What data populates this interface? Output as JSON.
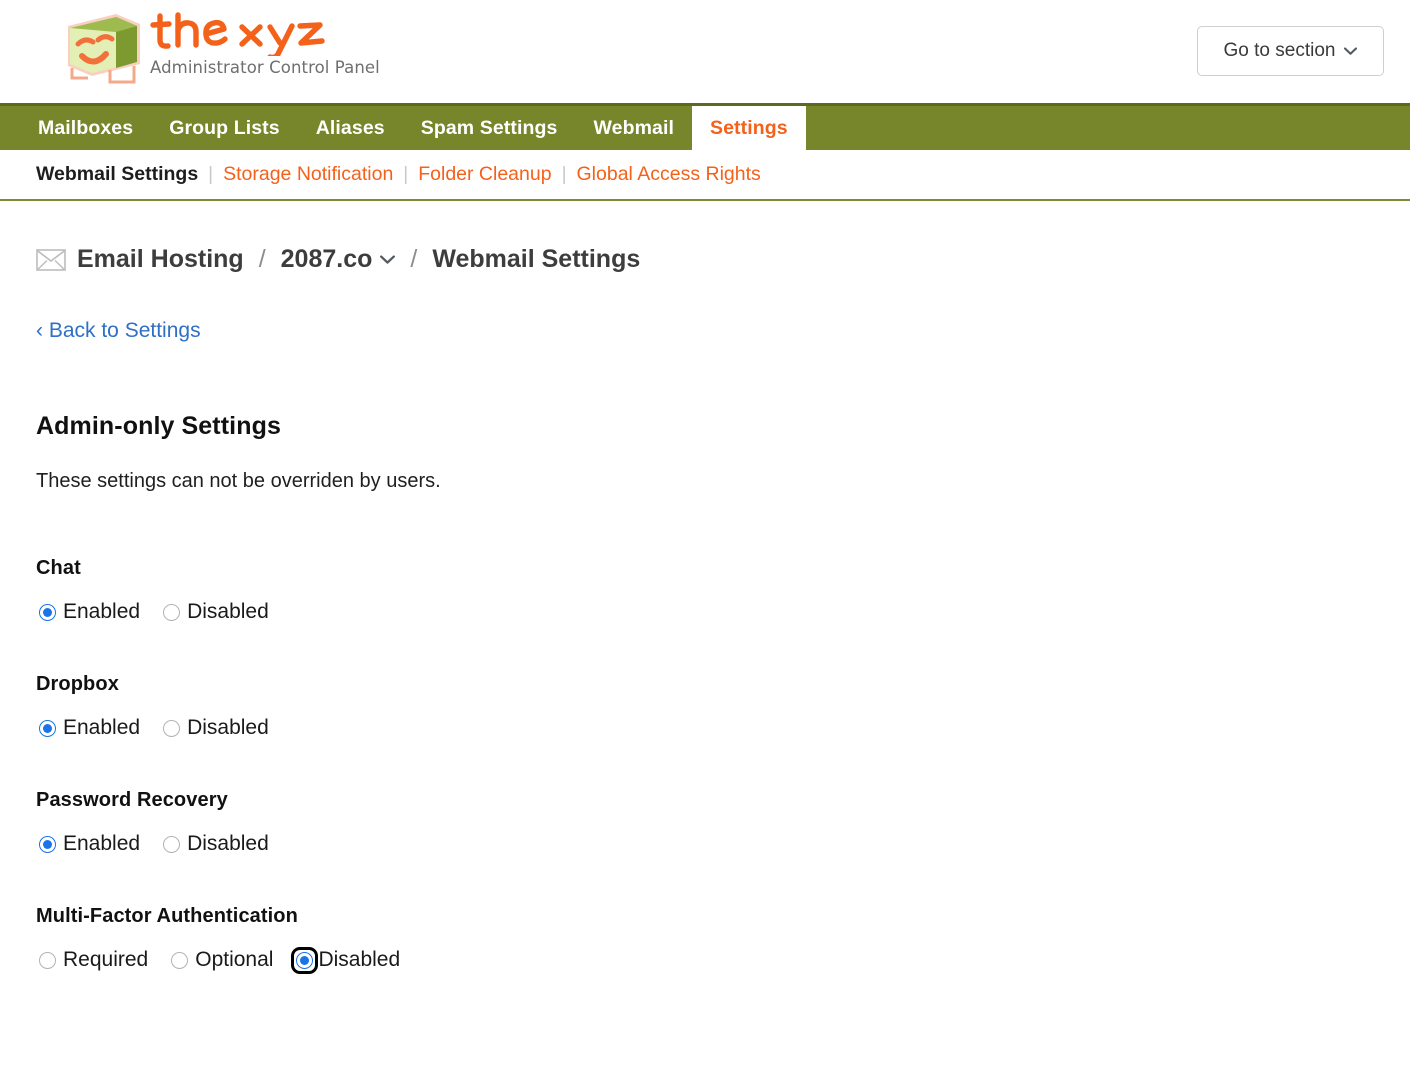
{
  "header": {
    "brand_name": "thexyz",
    "tagline": "Administrator Control Panel",
    "logo_icon": "green-box-face-logo",
    "go_to_section": {
      "label": "Go to section",
      "icon": "chevron-down-icon"
    }
  },
  "nav_primary": {
    "items": [
      {
        "label": "Mailboxes",
        "active": false
      },
      {
        "label": "Group Lists",
        "active": false
      },
      {
        "label": "Aliases",
        "active": false
      },
      {
        "label": "Spam Settings",
        "active": false
      },
      {
        "label": "Webmail",
        "active": false
      },
      {
        "label": "Settings",
        "active": true
      }
    ]
  },
  "nav_secondary": {
    "items": [
      {
        "label": "Webmail Settings",
        "current": true
      },
      {
        "label": "Storage Notification",
        "current": false
      },
      {
        "label": "Folder Cleanup",
        "current": false
      },
      {
        "label": "Global Access Rights",
        "current": false
      }
    ],
    "separator": "|"
  },
  "breadcrumb": {
    "icon": "envelope-icon",
    "root": "Email Hosting",
    "separator": "/",
    "domain": "2087.co",
    "domain_caret": "chevron-down-icon",
    "current": "Webmail Settings"
  },
  "back_link": "‹ Back to Settings",
  "main": {
    "title": "Admin-only Settings",
    "description": "These settings can not be overriden by users."
  },
  "settings": [
    {
      "label": "Chat",
      "options": [
        {
          "label": "Enabled",
          "checked": true,
          "focused": false
        },
        {
          "label": "Disabled",
          "checked": false,
          "focused": false
        }
      ]
    },
    {
      "label": "Dropbox",
      "options": [
        {
          "label": "Enabled",
          "checked": true,
          "focused": false
        },
        {
          "label": "Disabled",
          "checked": false,
          "focused": false
        }
      ]
    },
    {
      "label": "Password Recovery",
      "options": [
        {
          "label": "Enabled",
          "checked": true,
          "focused": false
        },
        {
          "label": "Disabled",
          "checked": false,
          "focused": false
        }
      ]
    },
    {
      "label": "Multi-Factor Authentication",
      "options": [
        {
          "label": "Required",
          "checked": false,
          "focused": false
        },
        {
          "label": "Optional",
          "checked": false,
          "focused": false
        },
        {
          "label": "Disabled",
          "checked": true,
          "focused": true
        }
      ]
    }
  ],
  "colors": {
    "nav_green": "#77862a",
    "nav_green_border": "#5d6a1e",
    "accent_orange": "#f4611a",
    "link_blue": "#2f6fc6",
    "radio_blue": "#1a73e8",
    "logo_green": "#d9e8a8",
    "logo_green_dark": "#6f8f2e",
    "logo_orange": "#f2804a"
  }
}
